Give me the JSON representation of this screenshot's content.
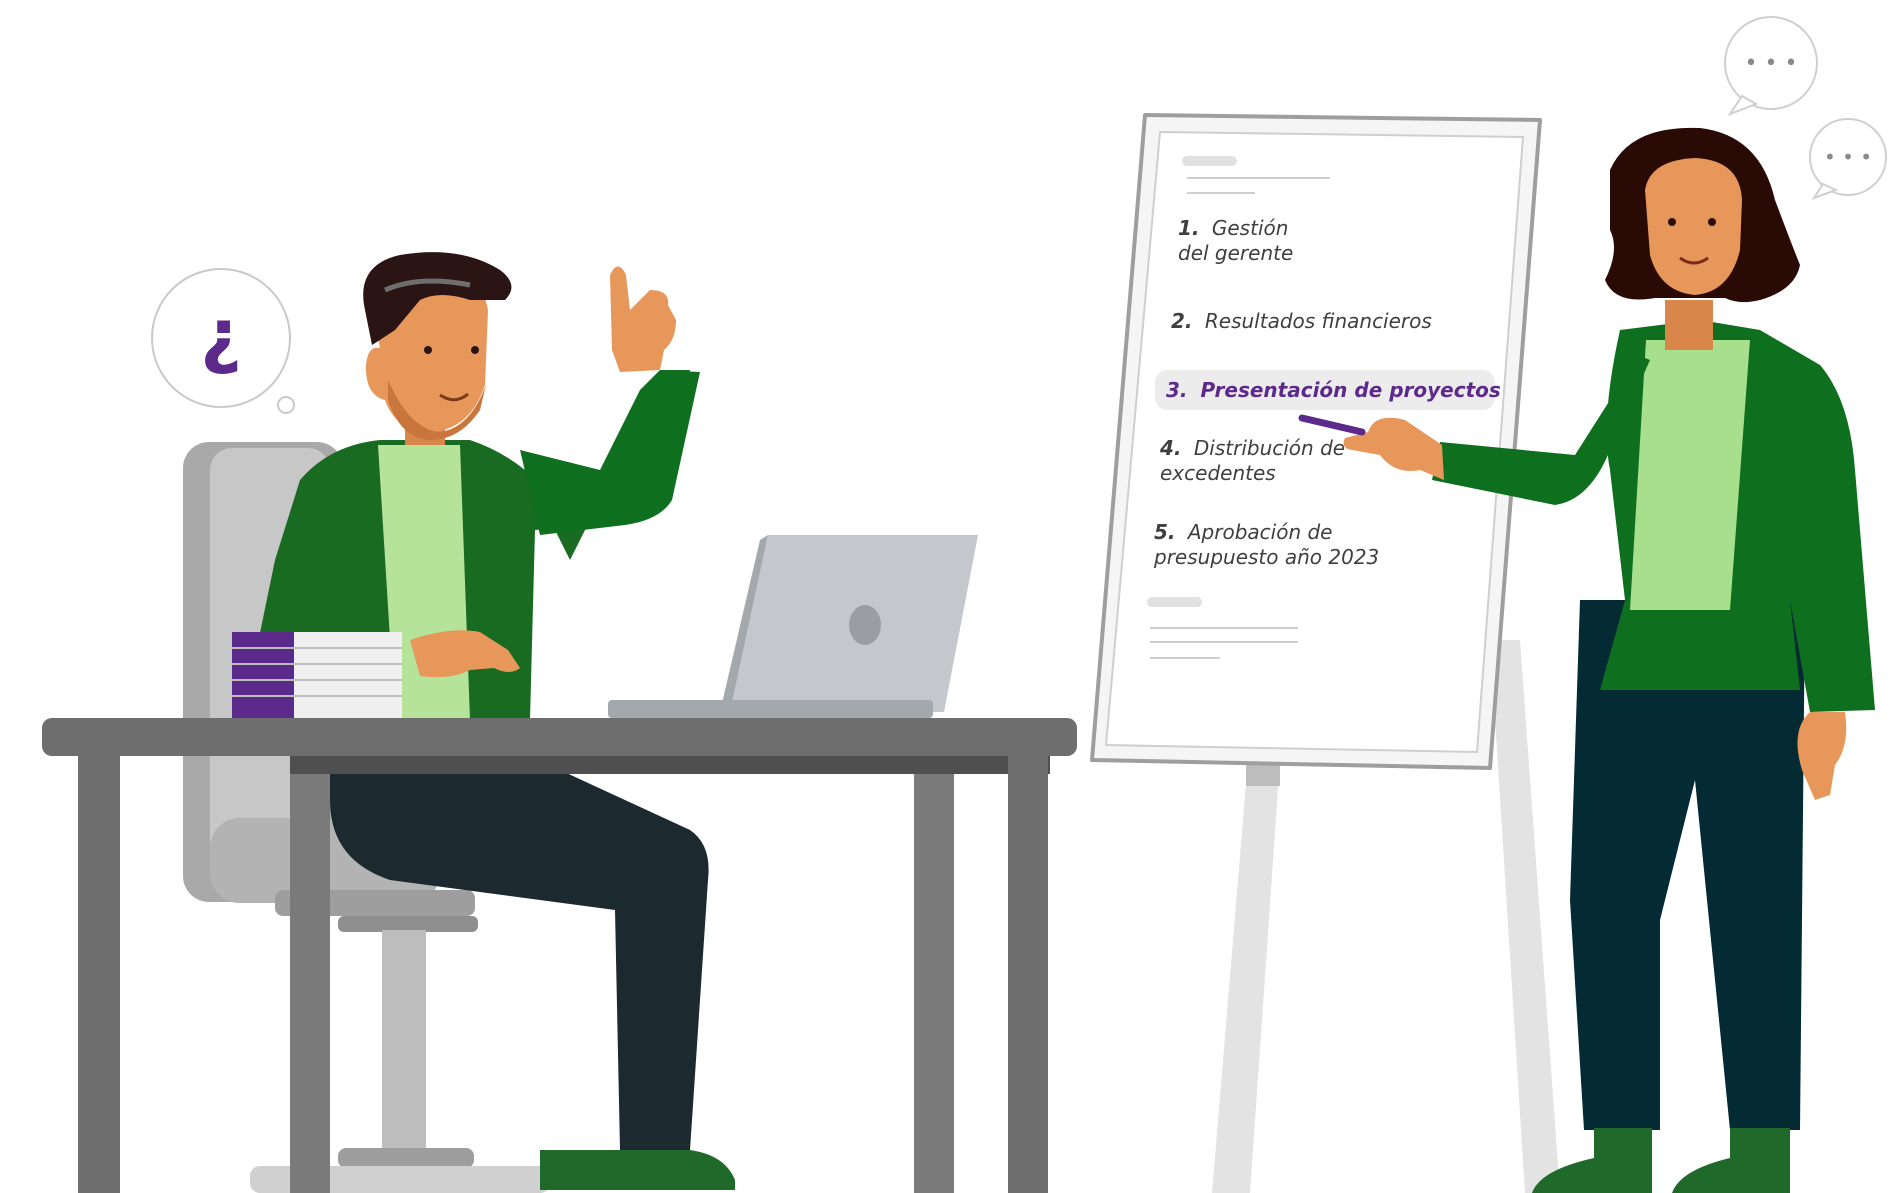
{
  "question_bubble": {
    "glyph": "¿"
  },
  "speech_bubbles": [
    {
      "text": "• • •"
    },
    {
      "text": "• • •"
    }
  ],
  "flipchart": {
    "agenda": [
      {
        "number": "1.",
        "lines": [
          "Gestión",
          "del gerente"
        ]
      },
      {
        "number": "2.",
        "lines": [
          "Resultados financieros"
        ]
      },
      {
        "number": "3.",
        "lines": [
          "Presentación de proyectos"
        ],
        "highlighted": true
      },
      {
        "number": "4.",
        "lines": [
          "Distribución de",
          "excedentes"
        ]
      },
      {
        "number": "5.",
        "lines": [
          "Aprobación de",
          "presupuesto año 2023"
        ]
      }
    ]
  },
  "colors": {
    "jacket_green": "#0e6f1f",
    "shirt_green": "#b6e39a",
    "accent_purple": "#5b2a8a",
    "skin": "#e8975a",
    "pants_dark": "#1c2a30",
    "desk_gray": "#6e6e6e"
  },
  "icons": [
    "question-mark-icon",
    "ellipsis-icon",
    "laptop-logo-icon"
  ]
}
